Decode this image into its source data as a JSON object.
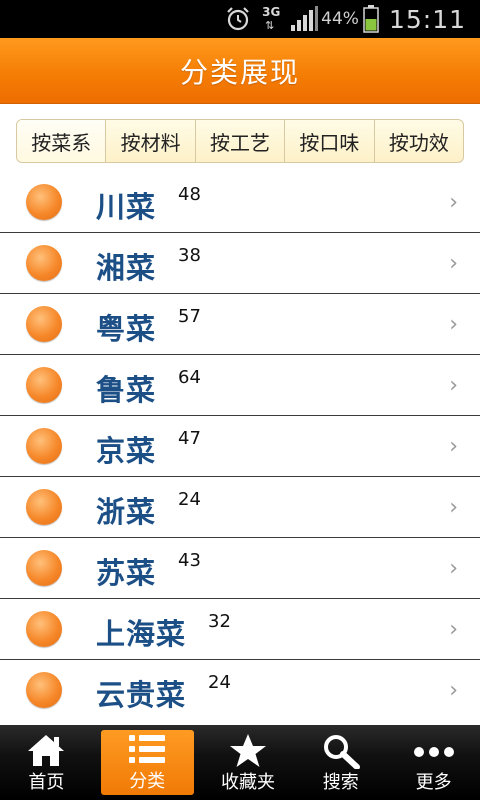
{
  "status_bar": {
    "battery_percent": "44%",
    "time": "15:11",
    "network": "3G",
    "icons": [
      "alarm-icon",
      "network-3g-icon",
      "signal-icon",
      "battery-icon"
    ]
  },
  "header": {
    "title": "分类展现"
  },
  "filter_tabs": [
    {
      "label": "按菜系",
      "active": true
    },
    {
      "label": "按材料",
      "active": false
    },
    {
      "label": "按工艺",
      "active": false
    },
    {
      "label": "按口味",
      "active": false
    },
    {
      "label": "按功效",
      "active": false
    }
  ],
  "categories": [
    {
      "name": "川菜",
      "count": "48"
    },
    {
      "name": "湘菜",
      "count": "38"
    },
    {
      "name": "粤菜",
      "count": "57"
    },
    {
      "name": "鲁菜",
      "count": "64"
    },
    {
      "name": "京菜",
      "count": "47"
    },
    {
      "name": "浙菜",
      "count": "24"
    },
    {
      "name": "苏菜",
      "count": "43"
    },
    {
      "name": "上海菜",
      "count": "32"
    },
    {
      "name": "云贵菜",
      "count": "24"
    }
  ],
  "list_chevron": "›",
  "bottom_nav": [
    {
      "label": "首页",
      "icon": "home-icon",
      "active": false
    },
    {
      "label": "分类",
      "icon": "list-icon",
      "active": true
    },
    {
      "label": "收藏夹",
      "icon": "star-icon",
      "active": false
    },
    {
      "label": "搜索",
      "icon": "search-icon",
      "active": false
    },
    {
      "label": "更多",
      "icon": "more-icon",
      "active": false
    }
  ],
  "colors": {
    "accent_orange": "#f57e05",
    "category_text": "#1b4f86",
    "tab_background": "#fdf1c8",
    "nav_background": "#111111"
  }
}
